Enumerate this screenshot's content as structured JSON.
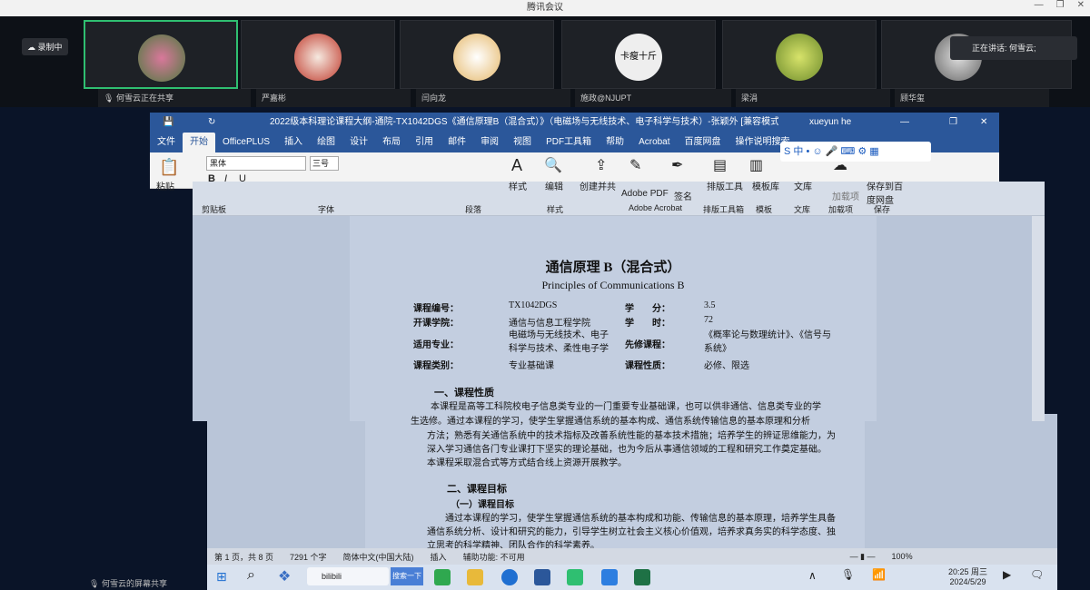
{
  "meeting": {
    "title": "腾讯会议",
    "recording": "录制中",
    "speaking": "正在讲话: 何雪云;",
    "share_status": "何雪云正在共享",
    "share_footer": "何雪云的屏幕共享",
    "participants": [
      {
        "name": "何雪云正在共享"
      },
      {
        "name": "严嘉彬"
      },
      {
        "name": "闫向龙"
      },
      {
        "name": "施政@NJUPT"
      },
      {
        "name": "梁涓"
      },
      {
        "name": "顾华玺"
      }
    ],
    "tile4_text": "卡瘦十斤"
  },
  "word": {
    "title": "2022级本科理论课程大纲-通院-TX1042DGS《通信原理B（混合式）》（电磁场与无线技术、电子科学与技术）-张颖外 [兼容模式] - Word",
    "user": "xueyun he",
    "tabs": [
      "文件",
      "开始",
      "OfficePLUS",
      "插入",
      "绘图",
      "设计",
      "布局",
      "引用",
      "邮件",
      "审阅",
      "视图",
      "PDF工具箱",
      "帮助",
      "Acrobat",
      "百度网盘",
      "操作说明搜索"
    ],
    "ribbon": {
      "font": "黑体",
      "size": "三号",
      "group_labels": [
        "剪贴板",
        "字体",
        "段落",
        "样式",
        "",
        "Adobe Acrobat",
        "排版工具箱",
        "模板",
        "文库",
        "加载项",
        "保存"
      ],
      "buttons": [
        "粘贴",
        "样式",
        "编辑",
        "创建并共",
        "Adobe PDF",
        "签名",
        "排版工具",
        "模板库",
        "文库",
        "加载项",
        "保存到百度网盘"
      ]
    },
    "doc": {
      "title": "通信原理 B（混合式）",
      "subtitle": "Principles of Communications B",
      "info": [
        [
          "课程编号：",
          "TX1042DGS",
          "学　　分：",
          "3.5"
        ],
        [
          "开课学院：",
          "通信与信息工程学院",
          "学　　时：",
          "72"
        ],
        [
          "适用专业：",
          "电磁场与无线技术、电子科学与技术、柔性电子学",
          "先修课程：",
          "《概率论与数理统计》、《信号与系统》"
        ],
        [
          "课程类别：",
          "专业基础课",
          "课程性质：",
          "必修、限选"
        ]
      ],
      "sec1": "一、课程性质",
      "p1a": "本课程是高等工科院校电子信息类专业的一门重要专业基础课，也可以供非通信、信息类专业的学",
      "p1b": "生选修。通过本课程的学习，使学生掌握通信系统的基本构成、通信系统传输信息的基本原理和分析",
      "p1c": "方法；熟悉有关通信系统中的技术指标及改善系统性能的基本技术措施；培养学生的辨证思维能力，为",
      "p1d": "深入学习通信各门专业课打下坚实的理论基础，也为今后从事通信领域的工程和研究工作奠定基础。",
      "p1e": "本课程采取混合式等方式结合线上资源开展教学。",
      "sec2": "二、课程目标",
      "sec2a": "（一）课程目标",
      "p2a": "通过本课程的学习，使学生掌握通信系统的基本构成和功能、传输信息的基本原理，培养学生具备",
      "p2b": "通信系统分析、设计和研究的能力，引导学生树立社会主义核心价值观，培养求真务实的科学态度、独",
      "p2c": "立思考的科学精神、团队合作的科学素养。"
    },
    "status": {
      "page": "第 1 页，共 8 页",
      "words": "7291 个字",
      "lang": "简体中文(中国大陆)",
      "mode": "插入",
      "access": "辅助功能: 不可用",
      "zoom": "100%"
    }
  },
  "taskbar": {
    "search": "bilibili",
    "search_btn": "搜索一下",
    "time": "20:25 周三",
    "date": "2024/5/29"
  }
}
